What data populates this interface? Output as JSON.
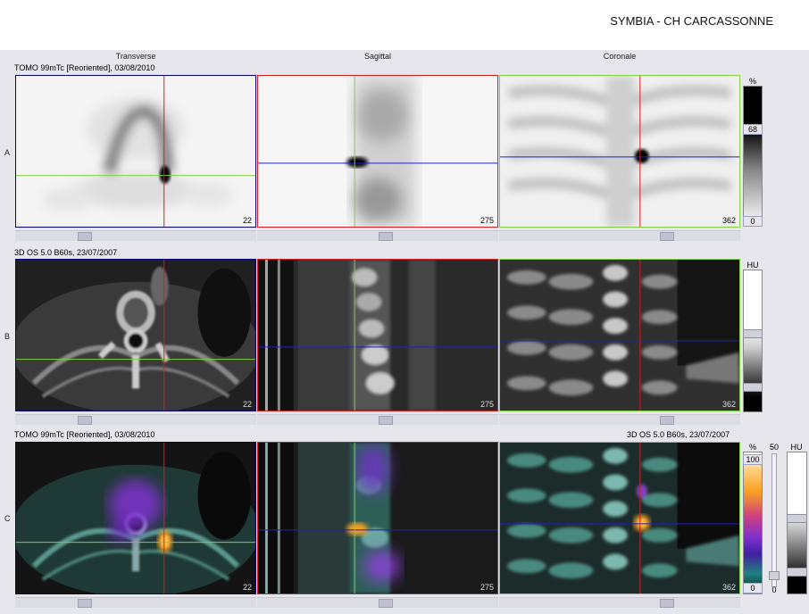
{
  "header": {
    "title": "SYMBIA - CH CARCASSONNE"
  },
  "columns": {
    "transverse": "Transverse",
    "sagittal": "Sagittal",
    "coronal": "Coronale"
  },
  "rows": {
    "a": {
      "label": "A",
      "series": "TOMO 99mTc [Reoriented], 03/08/2010"
    },
    "b": {
      "label": "B",
      "series": "3D  OS  5.0  B60s, 23/07/2007"
    },
    "c": {
      "label": "C",
      "series_left": "TOMO 99mTc [Reoriented], 03/08/2010",
      "series_right": "3D  OS  5.0  B60s, 23/07/2007"
    }
  },
  "slices": {
    "transverse": "22",
    "sagittal": "275",
    "coronal": "362"
  },
  "colorbars": {
    "a": {
      "unit": "%",
      "top": "68",
      "bottom": "0"
    },
    "b": {
      "unit": "HU"
    },
    "c": {
      "unit": "%",
      "top": "100",
      "bottom": "0",
      "slider_top": "50",
      "slider_bottom": "0",
      "hu_unit": "HU"
    }
  },
  "colors": {
    "crosshair_red": "#d02020",
    "crosshair_green": "#80d040",
    "crosshair_blue": "#2020c0",
    "frame_blue": "#000080"
  }
}
